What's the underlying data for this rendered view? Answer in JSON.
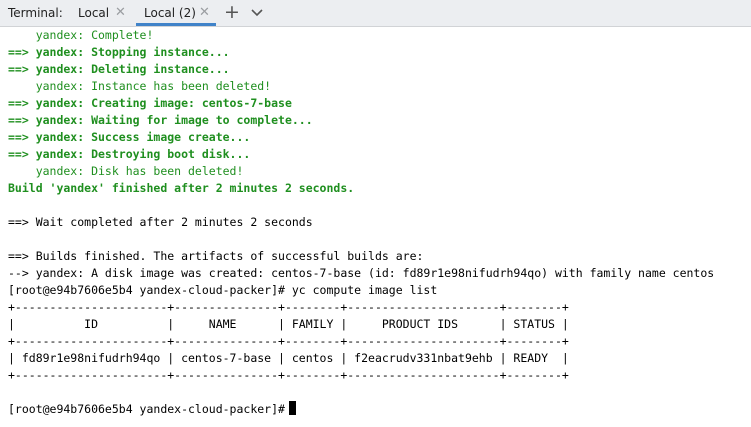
{
  "tabbar": {
    "label": "Terminal:",
    "tabs": [
      {
        "label": "Local",
        "active": false
      },
      {
        "label": "Local (2)",
        "active": true
      }
    ],
    "close_glyph": "✕",
    "add_glyph": "+",
    "icons": [
      "close-icon",
      "add-tab-icon",
      "chevron-down-icon"
    ],
    "accent_color": "#4083c9"
  },
  "terminal": {
    "lines": [
      {
        "text": "    yandex: Complete!",
        "style": "g"
      },
      {
        "text": "==> yandex: Stopping instance...",
        "style": "gb"
      },
      {
        "text": "==> yandex: Deleting instance...",
        "style": "gb"
      },
      {
        "text": "    yandex: Instance has been deleted!",
        "style": "g"
      },
      {
        "text": "==> yandex: Creating image: centos-7-base",
        "style": "gb"
      },
      {
        "text": "==> yandex: Waiting for image to complete...",
        "style": "gb"
      },
      {
        "text": "==> yandex: Success image create...",
        "style": "gb"
      },
      {
        "text": "==> yandex: Destroying boot disk...",
        "style": "gb"
      },
      {
        "text": "    yandex: Disk has been deleted!",
        "style": "g"
      },
      {
        "text": "Build 'yandex' finished after 2 minutes 2 seconds.",
        "style": "gb"
      },
      {
        "text": "",
        "style": "k"
      },
      {
        "text": "==> Wait completed after 2 minutes 2 seconds",
        "style": "k"
      },
      {
        "text": "",
        "style": "k"
      },
      {
        "text": "==> Builds finished. The artifacts of successful builds are:",
        "style": "k"
      },
      {
        "text": "--> yandex: A disk image was created: centos-7-base (id: fd89r1e98nifudrh94qo) with family name centos",
        "style": "k"
      },
      {
        "text": "[root@e94b7606e5b4 yandex-cloud-packer]# yc compute image list",
        "style": "k"
      },
      {
        "text": "+----------------------+---------------+--------+----------------------+--------+",
        "style": "k"
      },
      {
        "text": "|          ID          |     NAME      | FAMILY |     PRODUCT IDS      | STATUS |",
        "style": "k"
      },
      {
        "text": "+----------------------+---------------+--------+----------------------+--------+",
        "style": "k"
      },
      {
        "text": "| fd89r1e98nifudrh94qo | centos-7-base | centos | f2eacrudv331nbat9ehb | READY  |",
        "style": "k"
      },
      {
        "text": "+----------------------+---------------+--------+----------------------+--------+",
        "style": "k"
      },
      {
        "text": "",
        "style": "k"
      },
      {
        "text": "[root@e94b7606e5b4 yandex-cloud-packer]#",
        "style": "k"
      }
    ],
    "colors": {
      "green": "#1f8f1f",
      "text": "#000000",
      "background": "#ffffff"
    }
  }
}
